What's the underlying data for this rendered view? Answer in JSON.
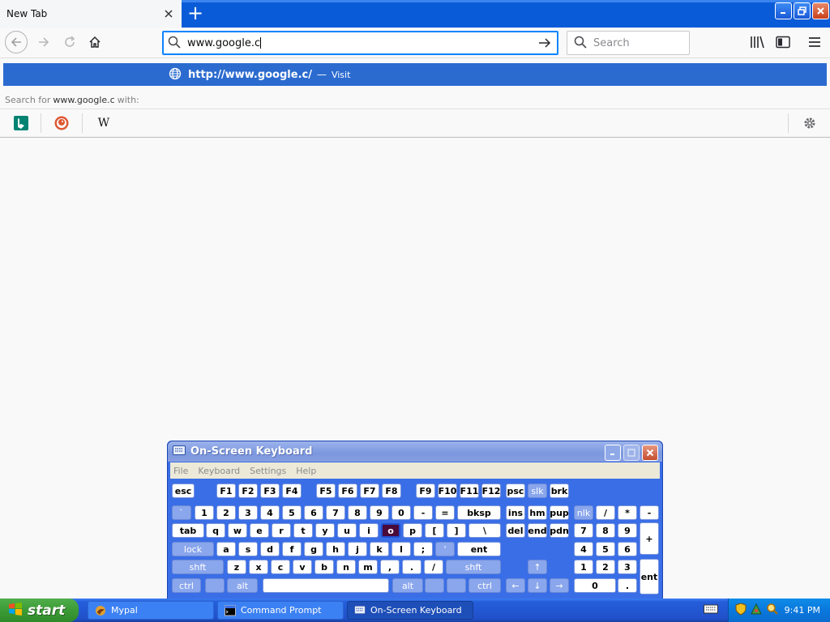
{
  "browser": {
    "tab_title": "New Tab",
    "new_tab_symbol": "+",
    "url_value": "www.google.c",
    "search_placeholder": "Search",
    "dropdown": {
      "url": "http://www.google.c/",
      "separator": "—",
      "action": "Visit"
    },
    "search_with_prefix": "Search for",
    "search_with_query": "www.google.c",
    "search_with_suffix": "with:",
    "engines": [
      "bing-icon",
      "duckduckgo-icon",
      "wikipedia-icon"
    ],
    "wikipedia_glyph": "W"
  },
  "osk": {
    "title": "On-Screen Keyboard",
    "menu": [
      "File",
      "Keyboard",
      "Settings",
      "Help"
    ],
    "rows": [
      [
        [
          "esc",
          212,
          28
        ],
        [
          "F1",
          267,
          24
        ],
        [
          "F2",
          294,
          24
        ],
        [
          "F3",
          321,
          24
        ],
        [
          "F4",
          348,
          24
        ],
        [
          "F5",
          390,
          24
        ],
        [
          "F6",
          417,
          24
        ],
        [
          "F7",
          444,
          24
        ],
        [
          "F8",
          471,
          24
        ],
        [
          "F9",
          513,
          24
        ],
        [
          "F10",
          540,
          24
        ],
        [
          "F11",
          567,
          24
        ],
        [
          "F12",
          594,
          24
        ],
        [
          "psc",
          624,
          24
        ],
        [
          "slk",
          651,
          24,
          "mod"
        ],
        [
          "brk",
          678,
          24
        ]
      ],
      [
        [
          "`",
          212,
          24,
          "mod"
        ],
        [
          "1",
          240,
          24
        ],
        [
          "2",
          267,
          24
        ],
        [
          "3",
          294,
          24
        ],
        [
          "4",
          321,
          24
        ],
        [
          "5",
          348,
          24
        ],
        [
          "6",
          375,
          24
        ],
        [
          "7",
          402,
          24
        ],
        [
          "8",
          429,
          24
        ],
        [
          "9",
          456,
          24
        ],
        [
          "0",
          483,
          24
        ],
        [
          "-",
          510,
          24
        ],
        [
          "=",
          537,
          24
        ],
        [
          "bksp",
          564,
          54
        ],
        [
          "ins",
          624,
          24
        ],
        [
          "hm",
          651,
          24
        ],
        [
          "pup",
          678,
          24
        ],
        [
          "nlk",
          708,
          24,
          "mod"
        ],
        [
          "/",
          735,
          24
        ],
        [
          "*",
          762,
          24
        ],
        [
          "-",
          789,
          24
        ]
      ],
      [
        [
          "tab",
          212,
          40
        ],
        [
          "q",
          254,
          24
        ],
        [
          "w",
          281,
          24
        ],
        [
          "e",
          308,
          24
        ],
        [
          "r",
          335,
          24
        ],
        [
          "t",
          362,
          24
        ],
        [
          "y",
          389,
          24
        ],
        [
          "u",
          416,
          24
        ],
        [
          "i",
          443,
          24
        ],
        [
          "o",
          470,
          24,
          "hl"
        ],
        [
          "p",
          497,
          24
        ],
        [
          "[",
          524,
          24
        ],
        [
          "]",
          551,
          24
        ],
        [
          "\\",
          578,
          40
        ],
        [
          "del",
          624,
          24
        ],
        [
          "end",
          651,
          24
        ],
        [
          "pdn",
          678,
          24
        ],
        [
          "7",
          708,
          24
        ],
        [
          "8",
          735,
          24
        ],
        [
          "9",
          762,
          24
        ]
      ],
      [
        [
          "lock",
          212,
          52,
          "mod"
        ],
        [
          "a",
          267,
          24
        ],
        [
          "s",
          294,
          24
        ],
        [
          "d",
          321,
          24
        ],
        [
          "f",
          348,
          24
        ],
        [
          "g",
          375,
          24
        ],
        [
          "h",
          402,
          24
        ],
        [
          "j",
          429,
          24
        ],
        [
          "k",
          456,
          24
        ],
        [
          "l",
          483,
          24
        ],
        [
          ";",
          510,
          24
        ],
        [
          "'",
          537,
          24,
          "mod"
        ],
        [
          "ent",
          564,
          54
        ],
        [
          "4",
          708,
          24
        ],
        [
          "5",
          735,
          24
        ],
        [
          "6",
          762,
          24
        ]
      ],
      [
        [
          "shft",
          212,
          64,
          "mod"
        ],
        [
          "z",
          280,
          24
        ],
        [
          "x",
          307,
          24
        ],
        [
          "c",
          334,
          24
        ],
        [
          "v",
          361,
          24
        ],
        [
          "b",
          388,
          24
        ],
        [
          "n",
          415,
          24
        ],
        [
          "m",
          442,
          24
        ],
        [
          ",",
          469,
          24
        ],
        [
          ".",
          496,
          24
        ],
        [
          "/",
          523,
          24
        ],
        [
          "shft",
          550,
          68,
          "mod"
        ],
        [
          "↑",
          651,
          24,
          "mod"
        ],
        [
          "1",
          708,
          24
        ],
        [
          "2",
          735,
          24
        ],
        [
          "3",
          762,
          24
        ]
      ],
      [
        [
          "ctrl",
          212,
          36,
          "mod"
        ],
        [
          "",
          253,
          24,
          "mod"
        ],
        [
          "alt",
          280,
          38,
          "mod"
        ],
        [
          "",
          324,
          156
        ],
        [
          "alt",
          484,
          38,
          "mod"
        ],
        [
          "",
          524,
          24,
          "mod"
        ],
        [
          "",
          551,
          24,
          "mod"
        ],
        [
          "ctrl",
          578,
          40,
          "mod"
        ],
        [
          "←",
          624,
          24,
          "mod"
        ],
        [
          "↓",
          651,
          24,
          "mod"
        ],
        [
          "→",
          678,
          24,
          "mod"
        ],
        [
          "0",
          708,
          52
        ],
        [
          ".",
          762,
          24
        ]
      ]
    ],
    "numpad_tall": [
      [
        "+",
        789,
        645,
        40
      ],
      [
        "ent",
        789,
        690,
        44
      ]
    ]
  },
  "taskbar": {
    "start_label": "start",
    "tasks": [
      {
        "label": "Mypal",
        "icon": "mypal-icon"
      },
      {
        "label": "Command Prompt",
        "icon": "cmd-icon"
      },
      {
        "label": "On-Screen Keyboard",
        "icon": "keyboard-icon"
      }
    ],
    "clock": "9:41 PM"
  }
}
